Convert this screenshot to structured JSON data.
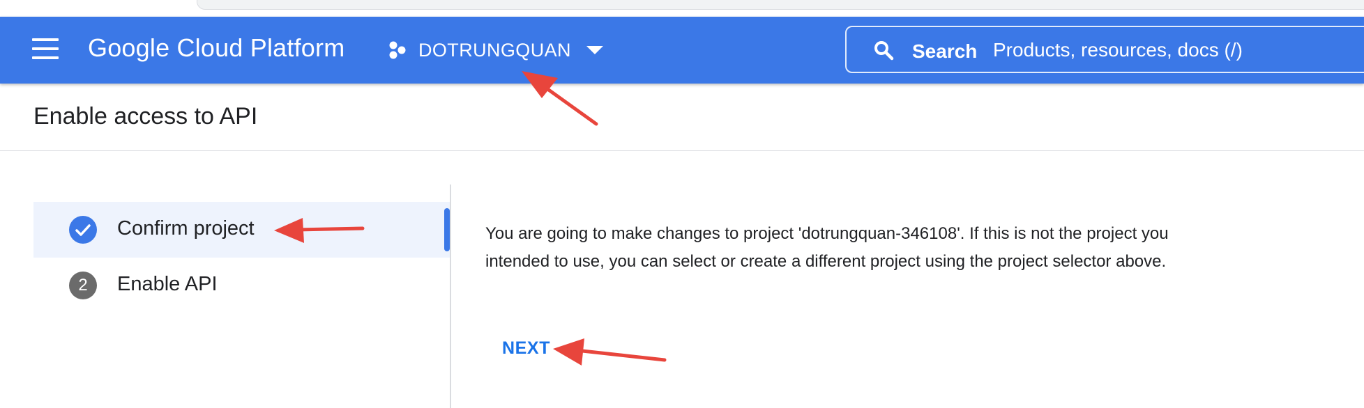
{
  "header": {
    "app_name": "Google Cloud Platform",
    "project_name": "DOTRUNGQUAN",
    "search": {
      "label": "Search",
      "placeholder": "Products, resources, docs (/)"
    },
    "background_color": "#3b78e7"
  },
  "page": {
    "title": "Enable access to API"
  },
  "stepper": {
    "steps": [
      {
        "label": "Confirm project",
        "state": "completed",
        "icon": "check-icon"
      },
      {
        "label": "Enable API",
        "number": "2",
        "state": "pending"
      }
    ]
  },
  "content": {
    "message": "You are going to make changes to project 'dotrungquan-346108'. If this is not the project you intended to use, you can select or create a different project using the project selector above.",
    "next_label": "NEXT"
  },
  "annotation_color": "#e8453c"
}
